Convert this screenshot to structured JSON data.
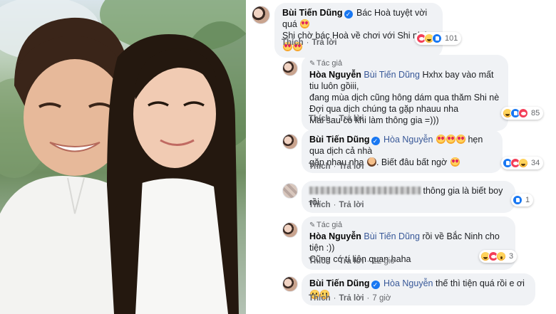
{
  "comments": [
    {
      "author": "Bùi Tiến Dũng",
      "verified": true,
      "lines": [
        "Bác Hoà tuyệt vời quá",
        "Shi chờ bác Hoà về chơi với Shi nhá"
      ],
      "actions": {
        "like": "Thích",
        "reply": "Trả lời"
      },
      "reactions": [
        "love",
        "haha",
        "like"
      ],
      "reaction_count": "101"
    },
    {
      "badge": "Tác giả",
      "author": "Hòa Nguyễn",
      "mention": "Bùi Tiến Dũng",
      "lines": [
        "Hxhx bay vào mất tiu luôn gồiii,",
        "đang mùa dịch cũng hông dám qua thăm Shi nè",
        "Đợi qua dịch chúng ta gặp nhauu nha",
        "Mai sau có khi làm thông gia =)))"
      ],
      "actions": {
        "like": "Thích",
        "reply": "Trả lời"
      },
      "reactions": [
        "haha",
        "like",
        "love"
      ],
      "reaction_count": "85"
    },
    {
      "author": "Bùi Tiến Dũng",
      "verified": true,
      "mention": "Hòa Nguyễn",
      "lines": [
        "hẹn qua dịch cả nhà",
        "gặp nhau nha",
        ". Biết đâu bất ngờ"
      ],
      "actions": {
        "like": "Thích",
        "reply": "Trả lời"
      },
      "reactions": [
        "like",
        "love",
        "haha"
      ],
      "reaction_count": "34"
    },
    {
      "author_hidden": true,
      "lines": [
        "thông gia là biết boy rồi"
      ],
      "actions": {
        "like": "Thích",
        "reply": "Trả lời"
      },
      "reactions": [
        "like"
      ],
      "reaction_count": "1"
    },
    {
      "badge": "Tác giả",
      "author": "Hòa Nguyễn",
      "mention": "Bùi Tiến Dũng",
      "lines": [
        "rồi về Bắc Ninh cho tiện :))",
        "Cũng có tí liên quan haha"
      ],
      "actions": {
        "like": "Thích",
        "reply": "Trả lời",
        "time": "22 giờ"
      },
      "reactions": [
        "haha",
        "love",
        "wow"
      ],
      "reaction_count": "3"
    },
    {
      "author": "Bùi Tiến Dũng",
      "verified": true,
      "mention": "Hòa Nguyễn",
      "lines": [
        "thế thì tiện quá rồi e ơi"
      ],
      "actions": {
        "like": "Thích",
        "reply": "Trả lời",
        "time": "7 giờ"
      }
    }
  ],
  "icons": {
    "verified": "verified-badge-icon",
    "author_badge": "pencil-icon"
  },
  "colors": {
    "bubble": "#f0f2f5",
    "link": "#385898",
    "verified": "#1877f2"
  }
}
